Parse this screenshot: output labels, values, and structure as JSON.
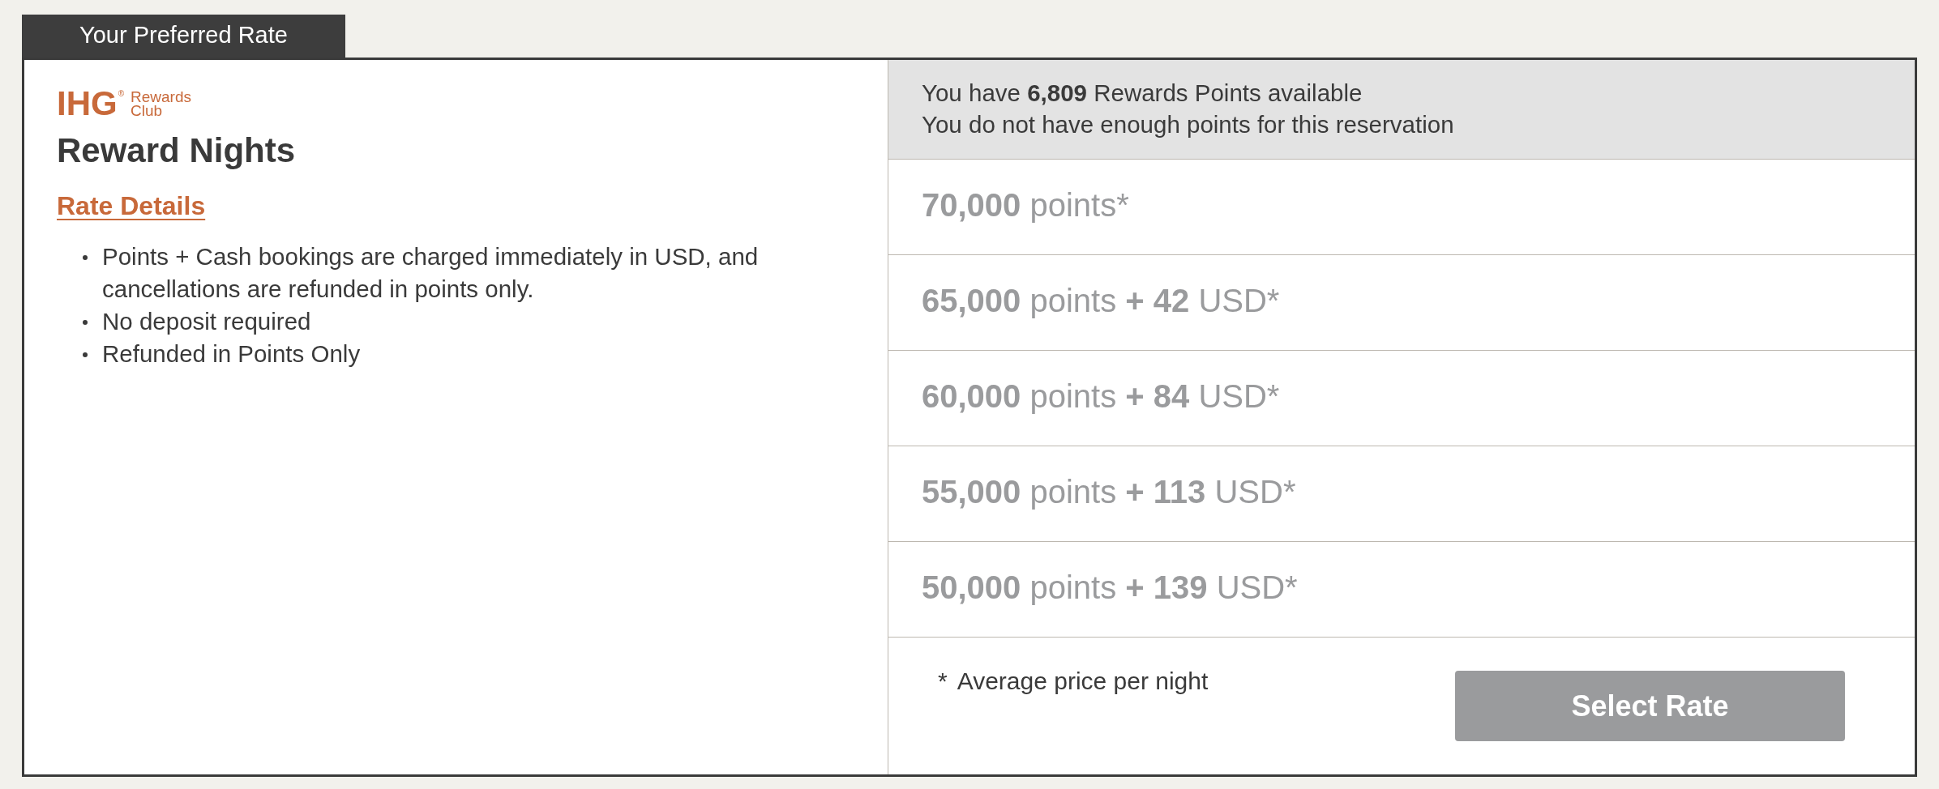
{
  "header_tab": {
    "label": "Your Preferred Rate"
  },
  "offer": {
    "logo": {
      "mark": "IHG",
      "registered": "®",
      "caption_line_1": "Rewards",
      "caption_line_2": "Club"
    },
    "title": "Reward Nights",
    "details_link": "Rate Details",
    "notes": [
      "Points + Cash bookings are charged immediately in USD, and cancellations are refunded in points only.",
      "No deposit required",
      "Refunded in Points Only"
    ]
  },
  "points_panel": {
    "balance": "You have **6,809** Rewards Points available",
    "warning": "You do not have enough points for this reservation",
    "options": [
      {
        "label": "**70,000** points*",
        "disabled": true
      },
      {
        "label": "**65,000** points **+ 42** USD*",
        "disabled": true
      },
      {
        "label": "**60,000** points **+ 84** USD*",
        "disabled": true
      },
      {
        "label": "**55,000** points **+ 113** USD*",
        "disabled": true
      },
      {
        "label": "**50,000** points **+ 139** USD*",
        "disabled": true
      }
    ],
    "footnote": {
      "mark": "*",
      "text": "Average price per night"
    },
    "button": {
      "label": "Select Rate",
      "disabled": true
    }
  }
}
